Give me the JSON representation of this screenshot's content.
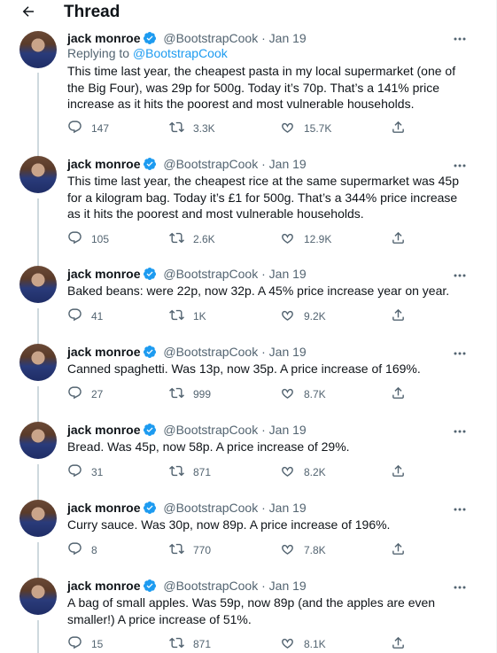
{
  "header": {
    "title": "Thread",
    "back_icon": "arrow-left-icon"
  },
  "colors": {
    "accent": "#1d9bf0",
    "muted": "#536471",
    "text": "#0f1419",
    "divider": "#eff3f4"
  },
  "tweets": [
    {
      "name": "jack monroe",
      "handle": "@BootstrapCook",
      "dot": "·",
      "date": "Jan 19",
      "replying_prefix": "Replying to ",
      "replying_to": "@BootstrapCook",
      "text": "This time last year, the cheapest pasta in my local supermarket (one of the Big Four), was 29p for 500g. Today it’s 70p. That’s a 141% price increase as it hits the poorest and most vulnerable households.",
      "replies": "147",
      "retweets": "3.3K",
      "likes": "15.7K"
    },
    {
      "name": "jack monroe",
      "handle": "@BootstrapCook",
      "dot": "·",
      "date": "Jan 19",
      "text": "This time last year, the cheapest rice at the same supermarket was 45p for a kilogram bag. Today it’s £1 for 500g. That’s a 344% price increase as it hits the poorest and most vulnerable households.",
      "replies": "105",
      "retweets": "2.6K",
      "likes": "12.9K"
    },
    {
      "name": "jack monroe",
      "handle": "@BootstrapCook",
      "dot": "·",
      "date": "Jan 19",
      "text": "Baked beans: were 22p, now 32p. A 45% price increase year on year.",
      "replies": "41",
      "retweets": "1K",
      "likes": "9.2K"
    },
    {
      "name": "jack monroe",
      "handle": "@BootstrapCook",
      "dot": "·",
      "date": "Jan 19",
      "text": "Canned spaghetti. Was 13p, now 35p. A price increase of 169%.",
      "replies": "27",
      "retweets": "999",
      "likes": "8.7K"
    },
    {
      "name": "jack monroe",
      "handle": "@BootstrapCook",
      "dot": "·",
      "date": "Jan 19",
      "text": "Bread. Was 45p, now 58p. A price increase of 29%.",
      "replies": "31",
      "retweets": "871",
      "likes": "8.2K"
    },
    {
      "name": "jack monroe",
      "handle": "@BootstrapCook",
      "dot": "·",
      "date": "Jan 19",
      "text": "Curry sauce. Was 30p, now 89p. A price increase of 196%.",
      "replies": "8",
      "retweets": "770",
      "likes": "7.8K"
    },
    {
      "name": "jack monroe",
      "handle": "@BootstrapCook",
      "dot": "·",
      "date": "Jan 19",
      "text": "A bag of small apples. Was 59p, now 89p (and the apples are even smaller!) A price increase of 51%.",
      "replies": "15",
      "retweets": "871",
      "likes": "8.1K"
    }
  ]
}
